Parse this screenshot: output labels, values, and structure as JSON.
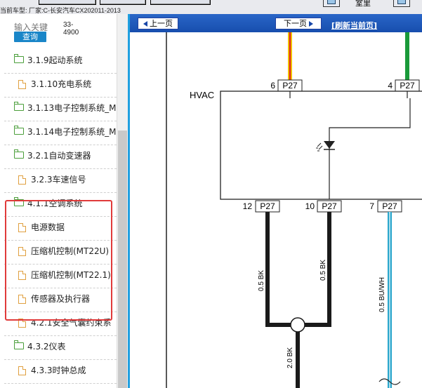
{
  "top": {
    "car_info": "当前车型:   厂家:C-长安汽车CX202011-2013",
    "right_label": "室里"
  },
  "search": {
    "placeholder": "输入关键",
    "button": "查询",
    "range": "33-\n4900"
  },
  "tree": [
    {
      "label": "3.1.9起动系统",
      "type": "folder"
    },
    {
      "label": "3.1.10充电系统",
      "type": "file"
    },
    {
      "label": "3.1.13电子控制系统_M",
      "type": "folder"
    },
    {
      "label": "3.1.14电子控制系统_M",
      "type": "folder"
    },
    {
      "label": "3.2.1自动变速器",
      "type": "folder"
    },
    {
      "label": "3.2.3车速信号",
      "type": "file"
    },
    {
      "label": "4.1.1空调系统",
      "type": "folder"
    },
    {
      "label": "电源数据",
      "type": "file"
    },
    {
      "label": "压缩机控制(MT22U)",
      "type": "file"
    },
    {
      "label": "压缩机控制(MT22.1)",
      "type": "file"
    },
    {
      "label": "传感器及执行器",
      "type": "file"
    },
    {
      "label": "4.2.1安全气囊约束系",
      "type": "file"
    },
    {
      "label": "4.3.2仪表",
      "type": "folder"
    },
    {
      "label": "4.3.3时钟总成",
      "type": "file"
    }
  ],
  "nav": {
    "prev": "上一页",
    "next": "下一页",
    "refresh": "[刷新当前页]"
  },
  "diagram": {
    "module_label": "HVAC",
    "top_pins": [
      {
        "pin": "6",
        "conn": "P27"
      },
      {
        "pin": "4",
        "conn": "P27"
      }
    ],
    "bottom_pins": [
      {
        "pin": "12",
        "conn": "P27"
      },
      {
        "pin": "10",
        "conn": "P27"
      },
      {
        "pin": "7",
        "conn": "P27"
      }
    ],
    "wire_labels": [
      "0.5 BK",
      "0.5 BK",
      "0.5 BU/WH",
      "2.0 BK"
    ],
    "colors": {
      "wire_black": "#1a1a1a",
      "wire_blue": "#2aa6cc",
      "wire_green": "#1a9a3a",
      "wire_yellow": "#f0c000",
      "wire_red": "#e02020",
      "highlight": "#e03a3a",
      "navbar": "#1f5bbd"
    }
  }
}
